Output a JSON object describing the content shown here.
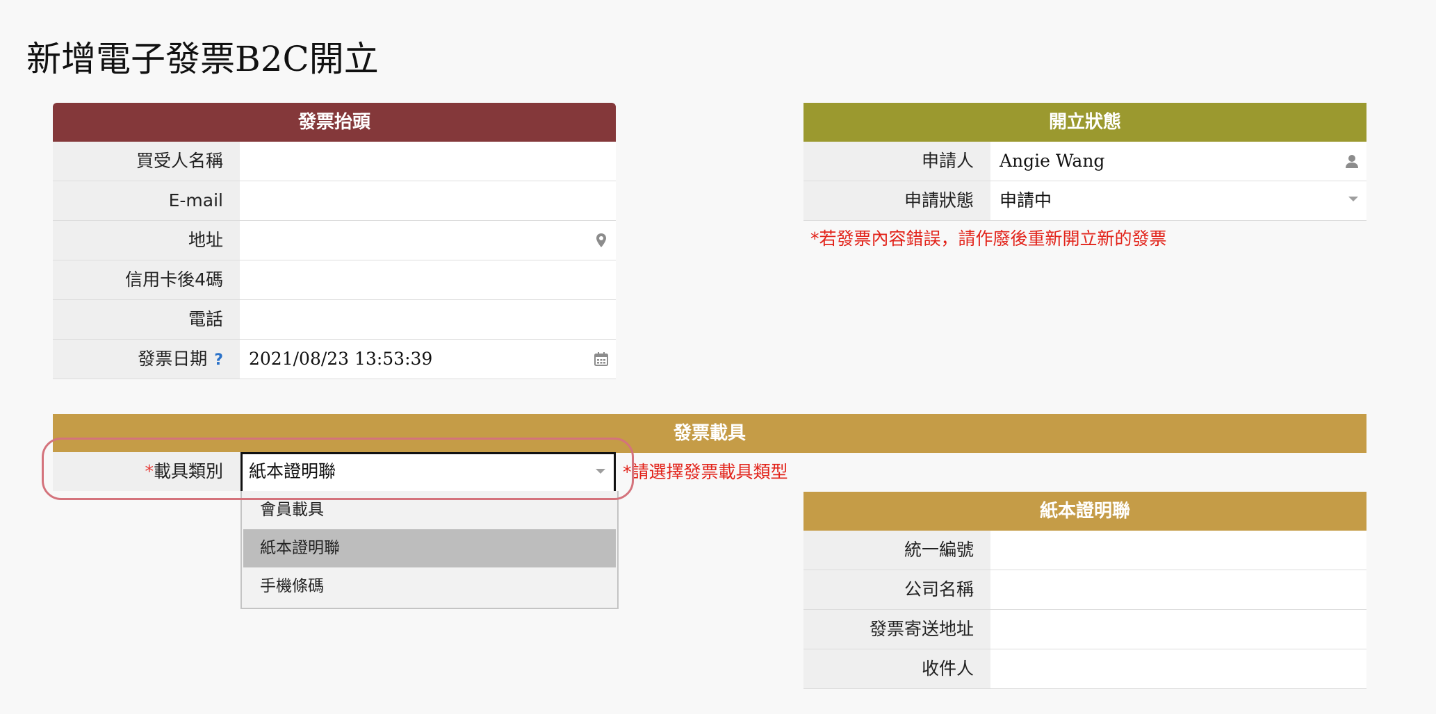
{
  "page_title": "新增電子發票B2C開立",
  "invoice_header": {
    "title": "發票抬頭",
    "fields": [
      {
        "label": "買受人名稱",
        "value": ""
      },
      {
        "label": "E-mail",
        "value": ""
      },
      {
        "label": "地址",
        "value": "",
        "icon": "map-marker-icon"
      },
      {
        "label": "信用卡後4碼",
        "value": ""
      },
      {
        "label": "電話",
        "value": ""
      },
      {
        "label": "發票日期",
        "value": "2021/08/23 13:53:39",
        "help": "?",
        "icon": "calendar-icon"
      }
    ]
  },
  "issue_status": {
    "title": "開立狀態",
    "fields": [
      {
        "label": "申請人",
        "value": "Angie Wang",
        "icon": "user-icon"
      },
      {
        "label": "申請狀態",
        "value": "申請中"
      }
    ],
    "note": "*若發票內容錯誤，請作廢後重新開立新的發票"
  },
  "carrier": {
    "title": "發票載具",
    "required_mark": "*",
    "label": "載具類別",
    "selected_value": "紙本證明聯",
    "hint": "*請選擇發票載具類型",
    "options": [
      "會員載具",
      "紙本證明聯",
      "手機條碼"
    ],
    "highlighted_option": "紙本證明聯"
  },
  "paper_proof": {
    "title": "紙本證明聯",
    "fields": [
      {
        "label": "統一編號",
        "value": ""
      },
      {
        "label": "公司名稱",
        "value": ""
      },
      {
        "label": "發票寄送地址",
        "value": ""
      },
      {
        "label": "收件人",
        "value": ""
      }
    ]
  },
  "colors": {
    "header_maroon": "#84383a",
    "header_olive": "#9b992f",
    "header_gold": "#c59c47",
    "error_red": "#e2231a",
    "highlight_pink": "#d4737c"
  }
}
